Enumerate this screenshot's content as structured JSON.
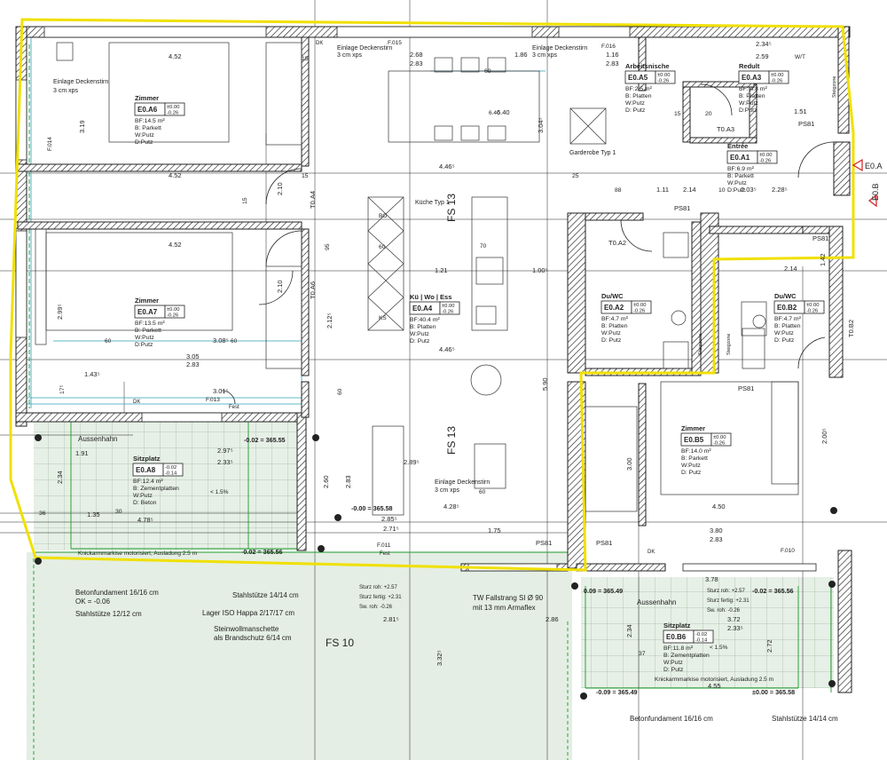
{
  "colors": {
    "wall_hatch": "#222222",
    "dimension": "#222222",
    "green_note": "#1b9a2a",
    "cyan_dim": "#2aa0b8",
    "red_marker": "#d21f1f",
    "unit_outline": "#f0e000",
    "terrace_fill": "#e3efe3"
  },
  "rooms": [
    {
      "name": "Zimmer",
      "code": "E0.A6",
      "lvl_top": "±0.00",
      "lvl_bot": "-0.26",
      "area": "BF:14.5 m²",
      "floor": "B: Parkett",
      "wall": "W:Putz",
      "ceiling": "D:Putz"
    },
    {
      "name": "Zimmer",
      "code": "E0.A7",
      "lvl_top": "±0.00",
      "lvl_bot": "-0.26",
      "area": "BF:13.5 m²",
      "floor": "B: Parkett",
      "wall": "W:Putz",
      "ceiling": "D:Putz"
    },
    {
      "name": "Sitzplatz",
      "code": "E0.A8",
      "lvl_top": "-0.02",
      "lvl_bot": "-0.14",
      "area": "BF:12.4 m²",
      "floor": "B: Zementplatten",
      "wall": "W:Putz",
      "ceiling": "D: Beton"
    },
    {
      "name": "Kü | Wo | Ess",
      "code": "E0.A4",
      "lvl_top": "±0.00",
      "lvl_bot": "-0.26",
      "area": "BF:40.4 m²",
      "floor": "B: Platten",
      "wall": "W:Putz",
      "ceiling": "D: Putz"
    },
    {
      "name": "Arbeitsnische",
      "code": "E0.A5",
      "lvl_top": "±0.00",
      "lvl_bot": "-0.26",
      "area": "BF:2.5 m²",
      "floor": "B: Platten",
      "wall": "W:Putz",
      "ceiling": "D: Putz"
    },
    {
      "name": "Redult",
      "code": "E0.A3",
      "lvl_top": "±0.00",
      "lvl_bot": "-0.26",
      "area": "BF: 4.8 m²",
      "floor": "B: Platten",
      "wall": "W:Putz",
      "ceiling": "D:Putz"
    },
    {
      "name": "Entrée",
      "code": "E0.A1",
      "lvl_top": "±0.00",
      "lvl_bot": "-0.26",
      "area": "BF:6.9 m²",
      "floor": "B: Parkett",
      "wall": "W:Putz",
      "ceiling": "D:Putz"
    },
    {
      "name": "Du/WC",
      "code": "E0.A2",
      "lvl_top": "±0.00",
      "lvl_bot": "-0.26",
      "area": "BF:4.7 m²",
      "floor": "B: Platten",
      "wall": "W:Putz",
      "ceiling": "D: Putz"
    },
    {
      "name": "Du/WC",
      "code": "E0.B2",
      "lvl_top": "±0.00",
      "lvl_bot": "-0.26",
      "area": "BF:4.7 m²",
      "floor": "B: Platten",
      "wall": "W:Putz",
      "ceiling": "D: Putz"
    },
    {
      "name": "Zimmer",
      "code": "E0.B5",
      "lvl_top": "±0.00",
      "lvl_bot": "-0.26",
      "area": "BF:14.0 m²",
      "floor": "B: Parkett",
      "wall": "W:Putz",
      "ceiling": "D: Putz"
    },
    {
      "name": "Sitzplatz",
      "code": "E0.B6",
      "lvl_top": "-0.02",
      "lvl_bot": "-0.14",
      "area": "BF:11.8 m²",
      "floor": "B: Zementplatten",
      "wall": "W:Putz",
      "ceiling": "D: Putz"
    }
  ],
  "dimensions": [
    "4.52",
    "4.52",
    "4.52",
    "2.68",
    "2.83",
    "1.86",
    "1.16",
    "2.83",
    "3.05",
    "2.83",
    "4.46⁵",
    "4.46⁵",
    "1.21",
    "1.00⁵",
    "1.91",
    "1.35",
    "2.34",
    "2.97⁵",
    "2.33⁵",
    "2.89⁵",
    "2.71⁵",
    "2.85⁵",
    "4.28⁵",
    "4.78⁵",
    "1.75",
    "3.80",
    "2.83",
    "4.50",
    "3.00",
    "2.14",
    "1.11",
    "2.34⁵",
    "2.59",
    "1.51",
    "6.40",
    "3.04⁵",
    "2.12⁵",
    "5.90",
    "2.00⁵",
    "3.72",
    "2.33⁵",
    "2.34",
    "2.72",
    "2.60",
    "2.83",
    "3.19",
    "2.99⁵",
    "2.81⁵",
    "2.86",
    "3.32⁵",
    "4.55",
    "3.78",
    "1.43⁵",
    "3.08⁵",
    "3.01⁵",
    "2.10",
    "2.10",
    "2.28⁵",
    "2.03⁵",
    "2.14",
    "1.42"
  ],
  "small_dims": [
    "15",
    "15",
    "15",
    "20",
    "88",
    "95",
    "25",
    "36",
    "17⁵",
    "60",
    "30",
    "37",
    "15",
    "10"
  ],
  "notes": {
    "green": [
      "Einlage Deckenstirn",
      "3 cm xps",
      "Einlage Deckenstirn",
      "3 cm xps",
      "Einlage Deckenstirn",
      "3 cm xps",
      "Einlage Deckenstirn",
      "3 cm xps"
    ],
    "kitchen": "Küche Typ 1",
    "garderobe": "Garderobe Typ 1",
    "fs": [
      "FS 13",
      "FS 13",
      "FS 10"
    ],
    "doors": [
      "T0.A3",
      "T0.A2",
      "T0.A4",
      "T0.A6",
      "T0.B2"
    ],
    "shafts": [
      "PS81",
      "PS81",
      "PS81",
      "PS81",
      "PS81",
      "PS81"
    ],
    "fest": [
      "Fest",
      "Fest",
      "DK",
      "DK",
      "DK"
    ],
    "bottom_labels": [
      "Betonfundament 16/16 cm",
      "OK = -0.06",
      "Stahlstütze 12/12 cm",
      "Stahlstütze 14/14 cm",
      "Lager ISO Happa 2/17/17 cm",
      "Steinwollmanschette",
      "als Brandschutz 6/14 cm",
      "TW Fallstrang SI Ø 90",
      "mit 13 mm Armaflex",
      "Aussenhahn",
      "Aussenhahn",
      "Betonfundament 16/16 cm",
      "Stahlstütze 14/14 cm"
    ],
    "levels": [
      "-0.02 = 365.55",
      "-0.02 = 365.56",
      "-0.00 = 365.58",
      "0.09 = 365.49",
      "-0.02 = 365.56",
      "-0.09 = 365.49",
      "±0.00 = 365.58"
    ],
    "awning_1": "Knickarmmarkise motorisiert, Ausladung 2.5 m",
    "awning_2": "Knickarmmarkise motorisiert, Ausladung 2.5 m",
    "sturz_1": [
      "Sturz roh: +2.57",
      "Sturz fertig: +2.31",
      "Sw. roh: -0.26"
    ],
    "sturz_2": [
      "Sturz roh: +2.57",
      "Sturz fertig: +2.31",
      "Sw. roh: -0.26"
    ],
    "steigzone": [
      "Steigzone",
      "Steigzone",
      "Steigzone"
    ],
    "edge_marks": [
      "E0.A",
      "E0.B"
    ],
    "misc": [
      "< 1.5%",
      "< 1.5%",
      "F.014",
      "F.013",
      "F.016",
      "F.010",
      "F.011",
      "F.015",
      "W/T",
      "6.40",
      "BO",
      "60",
      "KS",
      "70",
      "60",
      "60",
      "60",
      "60"
    ]
  }
}
